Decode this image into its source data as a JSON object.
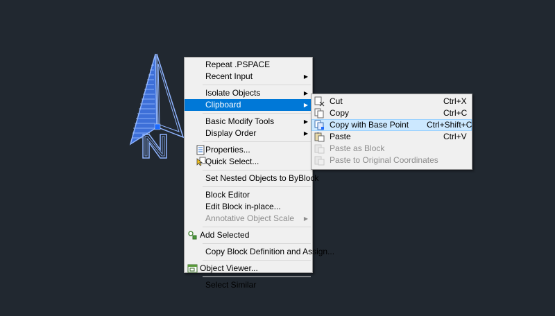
{
  "main_menu": {
    "repeat": "Repeat .PSPACE",
    "recent_input": "Recent Input",
    "isolate_objects": "Isolate Objects",
    "clipboard": "Clipboard",
    "basic_modify_tools": "Basic Modify Tools",
    "display_order": "Display Order",
    "properties": "Properties...",
    "quick_select": "Quick Select...",
    "set_nested": "Set Nested Objects to ByBlock",
    "block_editor": "Block Editor",
    "edit_block_inplace": "Edit Block in-place...",
    "annotative_scale": "Annotative Object Scale",
    "add_selected": "Add Selected",
    "copy_block_def": "Copy Block Definition and Assign...",
    "object_viewer": "Object Viewer...",
    "select_similar": "Select Similar"
  },
  "clipboard_menu": {
    "items": [
      {
        "label": "Cut",
        "shortcut": "Ctrl+X"
      },
      {
        "label": "Copy",
        "shortcut": "Ctrl+C"
      },
      {
        "label": "Copy with Base Point",
        "shortcut": "Ctrl+Shift+C"
      },
      {
        "label": "Paste",
        "shortcut": "Ctrl+V"
      },
      {
        "label": "Paste as Block",
        "shortcut": ""
      },
      {
        "label": "Paste to Original Coordinates",
        "shortcut": ""
      }
    ]
  },
  "drawing": {
    "north_letter": "N"
  },
  "colors": {
    "background": "#212830",
    "menu_bg": "#f0f0f0",
    "highlight": "#0078d7",
    "hover": "#cce8ff",
    "selection_blue": "#4a7fe0"
  }
}
